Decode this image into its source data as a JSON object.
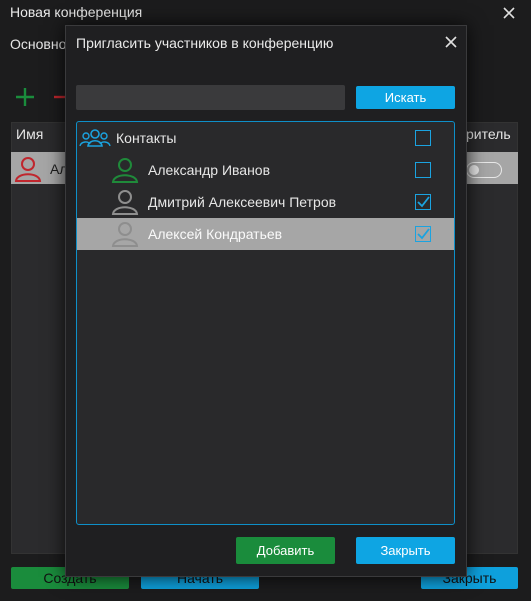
{
  "window": {
    "title": "Новая конференция",
    "tab_label": "Основно",
    "columns": {
      "name": "Имя",
      "role": "ритель"
    },
    "row": {
      "name": "Ал"
    },
    "buttons": {
      "create": "Создать",
      "start": "Начать",
      "close": "Закрыть"
    }
  },
  "dialog": {
    "title": "Пригласить участников в конференцию",
    "search": {
      "value": "",
      "placeholder": "",
      "button": "Искать"
    },
    "tree": {
      "group": {
        "label": "Контакты",
        "checked": false
      },
      "contacts": [
        {
          "name": "Александр Иванов",
          "status_color": "#1f8a3a",
          "checked": false,
          "selected": false
        },
        {
          "name": "Дмитрий Алексеевич Петров",
          "status_color": "#8e8e8e",
          "checked": true,
          "selected": false
        },
        {
          "name": "Алексей Кондратьев",
          "status_color": "#8e8e8e",
          "checked": true,
          "selected": true
        }
      ]
    },
    "buttons": {
      "add": "Добавить",
      "close": "Закрыть"
    }
  },
  "colors": {
    "accent_blue": "#0ea5e3",
    "accent_green": "#1a8c3c",
    "danger_red": "#c0262d"
  },
  "icons": {
    "group": "group-icon",
    "contact": "user-icon",
    "add": "plus-icon",
    "remove": "minus-icon",
    "close": "close-icon",
    "check": "check-icon"
  }
}
